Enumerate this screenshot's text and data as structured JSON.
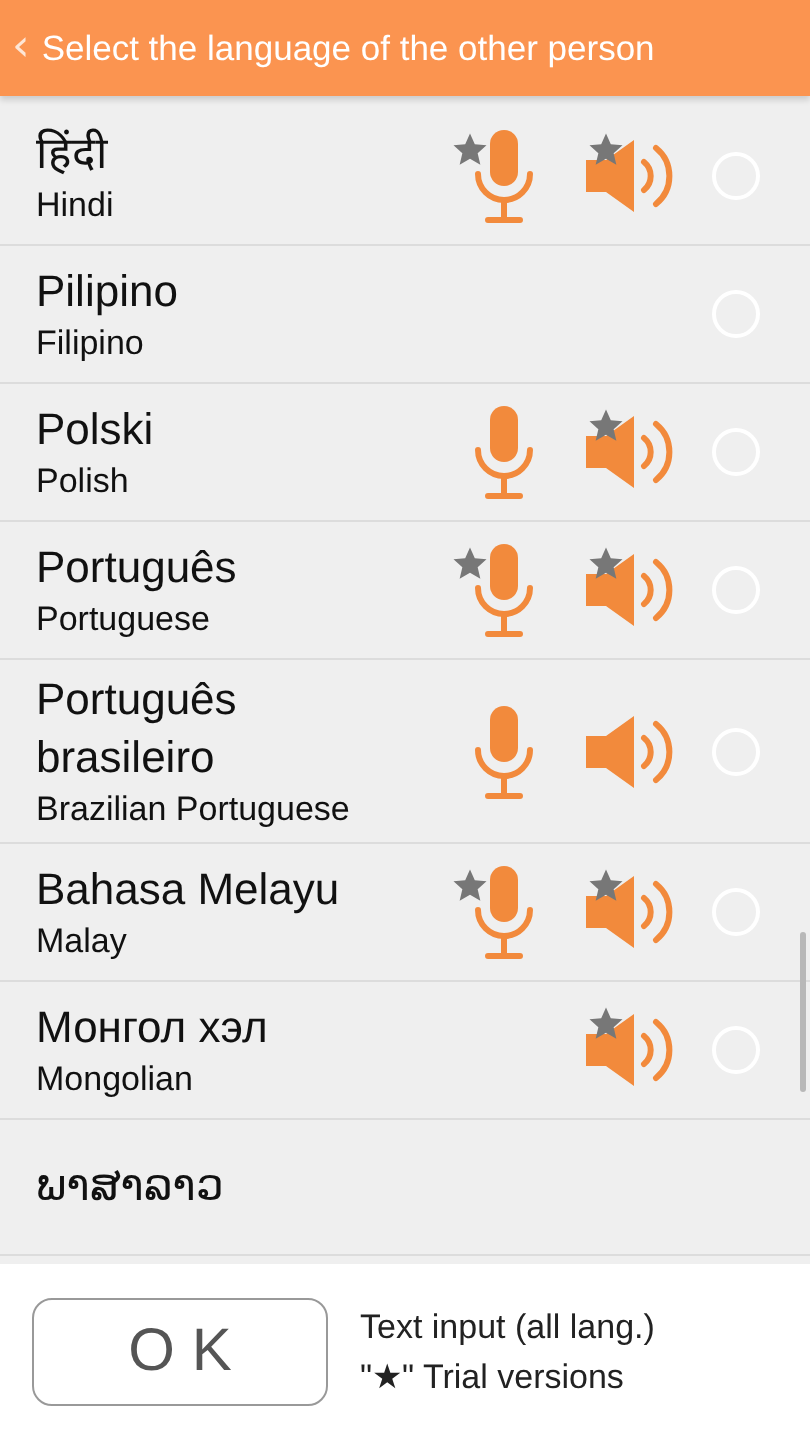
{
  "header": {
    "back_glyph": "‹",
    "title": "Select the language of the other person"
  },
  "languages": [
    {
      "native": "हिंदी",
      "english": "Hindi",
      "voice_input": true,
      "voice_input_trial": true,
      "speech_output": true,
      "speech_output_trial": true,
      "selected": false
    },
    {
      "native": "Pilipino",
      "english": "Filipino",
      "voice_input": false,
      "speech_output": false,
      "selected": false
    },
    {
      "native": "Polski",
      "english": "Polish",
      "voice_input": true,
      "voice_input_trial": false,
      "speech_output": true,
      "speech_output_trial": true,
      "selected": false
    },
    {
      "native": "Português",
      "english": "Portuguese",
      "voice_input": true,
      "voice_input_trial": true,
      "speech_output": true,
      "speech_output_trial": true,
      "selected": false
    },
    {
      "native": "Português brasileiro",
      "english": "Brazilian Portuguese",
      "voice_input": true,
      "voice_input_trial": false,
      "speech_output": true,
      "speech_output_trial": false,
      "selected": false
    },
    {
      "native": "Bahasa Melayu",
      "english": "Malay",
      "voice_input": true,
      "voice_input_trial": true,
      "speech_output": true,
      "speech_output_trial": true,
      "selected": false
    },
    {
      "native": "Монгол хэл",
      "english": "Mongolian",
      "voice_input": false,
      "speech_output": true,
      "speech_output_trial": true,
      "selected": false
    },
    {
      "native": "ພາສາລາວ"
    }
  ],
  "footer": {
    "ok_button": "O K",
    "notes": [
      "Text input (all lang.)",
      "\"★\" Trial versions"
    ]
  }
}
